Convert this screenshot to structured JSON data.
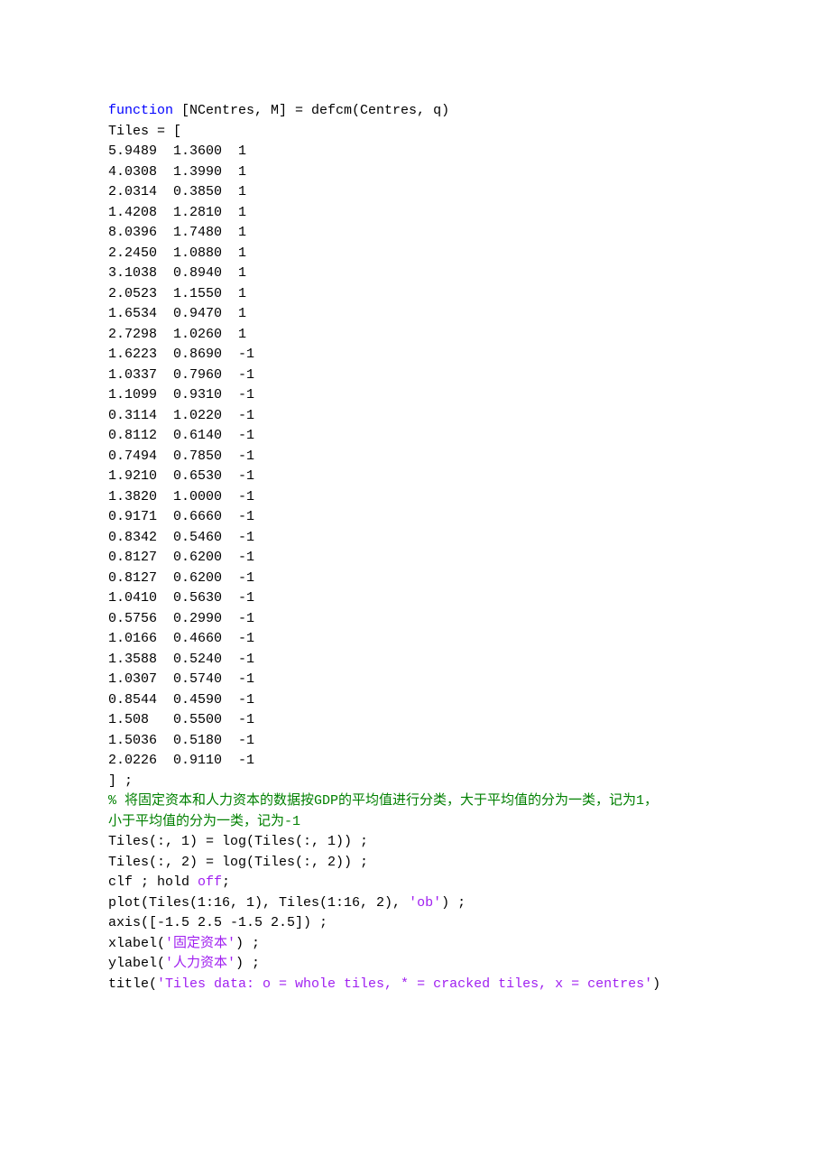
{
  "code": {
    "fn_keyword": "function",
    "fn_sig": " [NCentres, M] = defcm(Centres, q)",
    "tiles_open": "Tiles = [",
    "data_rows": [
      "5.9489  1.3600  1",
      "4.0308  1.3990  1",
      "2.0314  0.3850  1",
      "1.4208  1.2810  1",
      "8.0396  1.7480  1",
      "2.2450  1.0880  1",
      "3.1038  0.8940  1",
      "2.0523  1.1550  1",
      "1.6534  0.9470  1",
      "2.7298  1.0260  1",
      "1.6223  0.8690  -1",
      "1.0337  0.7960  -1",
      "1.1099  0.9310  -1",
      "0.3114  1.0220  -1",
      "0.8112  0.6140  -1",
      "0.7494  0.7850  -1",
      "1.9210  0.6530  -1",
      "1.3820  1.0000  -1",
      "0.9171  0.6660  -1",
      "0.8342  0.5460  -1",
      "0.8127  0.6200  -1",
      "0.8127  0.6200  -1",
      "1.0410  0.5630  -1",
      "0.5756  0.2990  -1",
      "1.0166  0.4660  -1",
      "1.3588  0.5240  -1",
      "1.0307  0.5740  -1",
      "0.8544  0.4590  -1",
      "1.508   0.5500  -1",
      "1.5036  0.5180  -1",
      "2.0226  0.9110  -1"
    ],
    "tiles_close": "] ;",
    "comment_l1": "% 将固定资本和人力资本的数据按GDP的平均值进行分类，大于平均值的分为一类，记为1，",
    "comment_l2": "小于平均值的分为一类，记为-1",
    "log1": "Tiles(:, 1) = log(Tiles(:, 1)) ;",
    "log2": "Tiles(:, 2) = log(Tiles(:, 2)) ;",
    "clf_pre": "clf ; hold ",
    "off_kw": "off",
    "clf_post": ";",
    "plot_pre": "plot(Tiles(1:16, 1), Tiles(1:16, 2), ",
    "plot_str": "'ob'",
    "plot_post": ") ;",
    "axis": "axis([-1.5 2.5 -1.5 2.5]) ;",
    "xlabel_pre": "xlabel(",
    "xlabel_str": "'固定资本'",
    "xlabel_post": ") ;",
    "ylabel_pre": "ylabel(",
    "ylabel_str": "'人力资本'",
    "ylabel_post": ") ;",
    "title_pre": "title(",
    "title_str": "'Tiles data: o = whole tiles, * = cracked tiles, x = centres'",
    "title_post": ")"
  }
}
